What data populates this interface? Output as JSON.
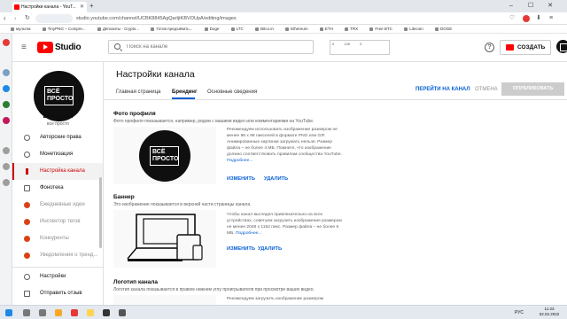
{
  "browser": {
    "tab_title": "Настройки канала - YouT...",
    "url": "studio.youtube.com/channel/UCBK8845AgQarIjtKBVOUpA/editing/images",
    "bookmarks": [
      "мультик",
      "TinyPNG – Compre...",
      "Депозиты - Crypto...",
      "Готов предъявить...",
      "Doge",
      "LTC",
      "Bitco.in",
      "Ethereum",
      "ETH",
      "TRX",
      "Free BTC",
      "Litecoin",
      "DOGE"
    ]
  },
  "header": {
    "brand": "Studio",
    "search_placeholder": "Поиск на канале",
    "create_label": "СОЗДАТЬ",
    "widget_values": [
      "0",
      "125",
      "0"
    ]
  },
  "sidebar": {
    "channel_name": "Ваш канал",
    "channel_sub": "все просто",
    "avatar_text": "ВСЁ ПРОСТО",
    "items": [
      {
        "label": "Авторские права"
      },
      {
        "label": "Монетизация"
      },
      {
        "label": "Настройка канала"
      },
      {
        "label": "Фонотека"
      },
      {
        "label": "Ежедневные идеи"
      },
      {
        "label": "Инспектор тегов"
      },
      {
        "label": "Конкуренты"
      },
      {
        "label": "Уведомления о тренд..."
      },
      {
        "label": "Настройки"
      },
      {
        "label": "Отправить отзыв"
      }
    ]
  },
  "main": {
    "title": "Настройки канала",
    "tabs": [
      "Главная страница",
      "Брендинг",
      "Основные сведения"
    ],
    "view_channel": "ПЕРЕЙТИ НА КАНАЛ",
    "cancel": "ОТМЕНА",
    "publish": "ОПУБЛИКОВАТЬ",
    "profile": {
      "title": "Фото профиля",
      "desc": "Фото профиля показывается, например, рядом с вашими видео или комментариями на YouTube.",
      "hint": "Рекомендуем использовать изображение размером не менее 98 x 98 пикселей в формате PNG или GIF. Анимированные картинки загружать нельзя. Размер файла – не более 4 МБ. Помните, что изображение должно соответствовать правилам сообщества YouTube.",
      "more": "Подробнее...",
      "change": "ИЗМЕНИТЬ",
      "remove": "УДАЛИТЬ"
    },
    "banner": {
      "title": "Баннер",
      "desc": "Это изображение показывается в верхней части страницы канала.",
      "hint": "Чтобы канал выглядел привлекательно на всех устройствах, советуем загрузить изображение размером не менее 2048 x 1152 пикс. Размер файла – не более 6 МБ.",
      "more": "Подробнее...",
      "change": "ИЗМЕНИТЬ",
      "remove": "УДАЛИТЬ"
    },
    "watermark": {
      "title": "Логотип канала",
      "desc": "Логотип канала показывается в правом нижнем углу проигрывателя при просмотре ваших видео.",
      "hint": "Рекомендуем загрузить изображение размером"
    }
  },
  "taskbar": {
    "lang": "РУС",
    "time": "11:23",
    "date": "02.02.2022"
  }
}
